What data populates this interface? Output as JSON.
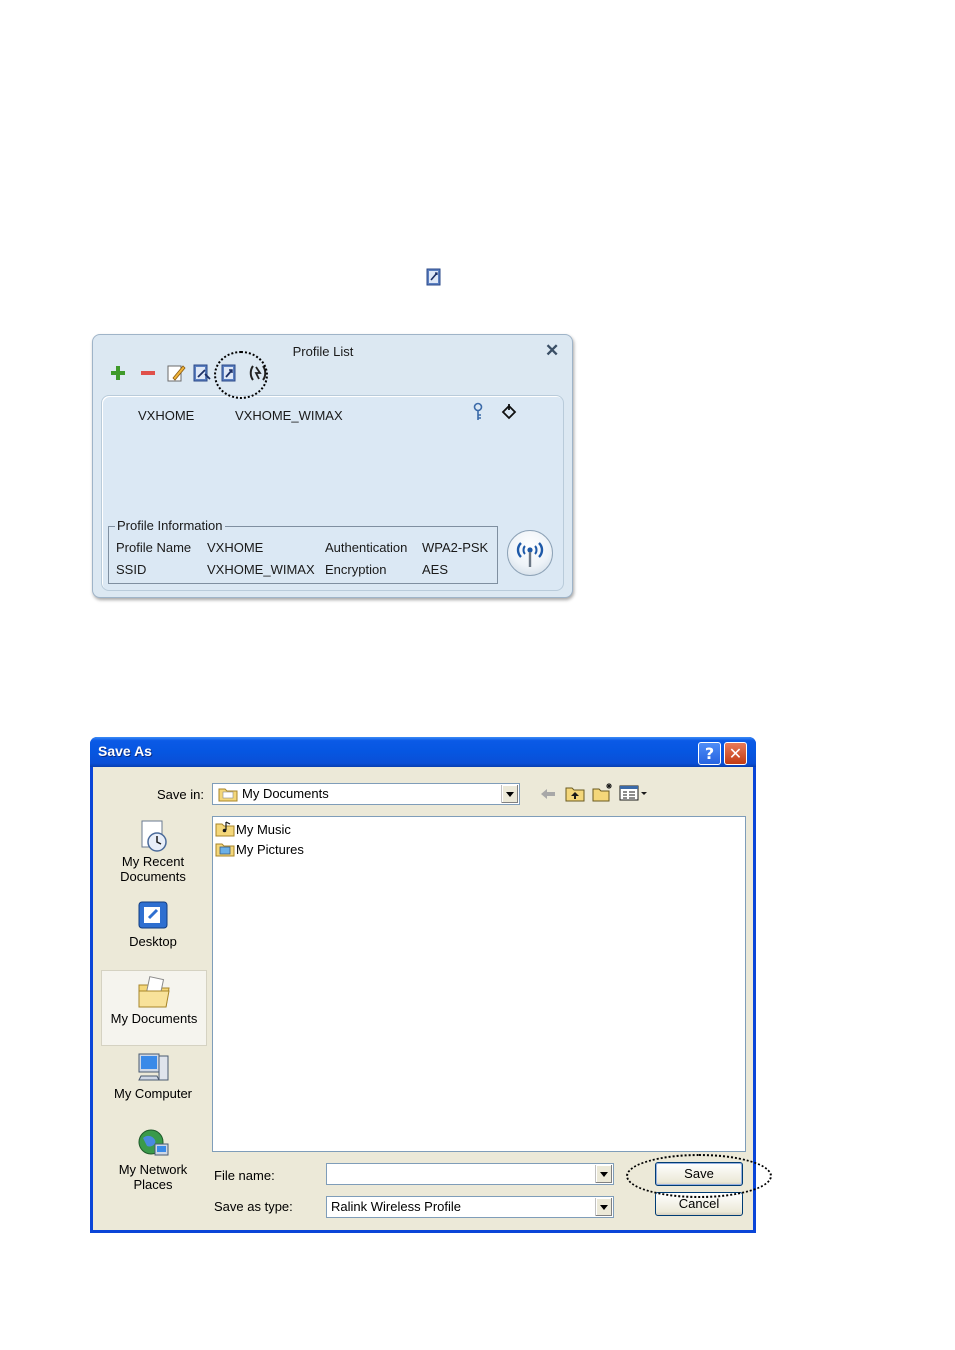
{
  "profile_list": {
    "title": "Profile List",
    "close_glyph": "✕",
    "toolbar_icons": [
      "plus-icon",
      "minus-icon",
      "edit-icon",
      "import-icon",
      "export-icon",
      "connect-icon"
    ],
    "entry": {
      "profile_name": "VXHOME",
      "ssid": "VXHOME_WIMAX",
      "icons": [
        "key-icon",
        "signal-icon"
      ]
    },
    "info": {
      "legend": "Profile Information",
      "profile_name_label": "Profile Name",
      "profile_name_value": "VXHOME",
      "ssid_label": "SSID",
      "ssid_value": "VXHOME_WIMAX",
      "authentication_label": "Authentication",
      "authentication_value": "WPA2-PSK",
      "encryption_label": "Encryption",
      "encryption_value": "AES"
    }
  },
  "save_as": {
    "title": "Save As",
    "help_glyph": "?",
    "close_glyph": "✕",
    "save_in_label": "Save in:",
    "save_in_value": "My Documents",
    "places": [
      {
        "label": "My Recent Documents",
        "icon": "recent-documents-icon"
      },
      {
        "label": "Desktop",
        "icon": "desktop-icon"
      },
      {
        "label": "My Documents",
        "icon": "my-documents-icon"
      },
      {
        "label": "My Computer",
        "icon": "my-computer-icon"
      },
      {
        "label": "My Network Places",
        "icon": "network-places-icon"
      }
    ],
    "files": [
      "My Music",
      "My Pictures"
    ],
    "file_name_label": "File name:",
    "file_name_value": "",
    "save_as_type_label": "Save as type:",
    "save_as_type_value": "Ralink Wireless Profile",
    "save_button": "Save",
    "cancel_button": "Cancel"
  }
}
